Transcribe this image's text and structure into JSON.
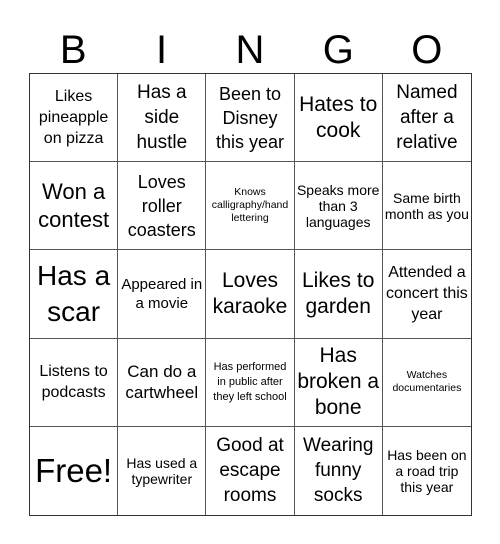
{
  "header": {
    "letters": [
      "B",
      "I",
      "N",
      "G",
      "O"
    ]
  },
  "cells": [
    {
      "text": "Likes pineapple on pizza",
      "size": "s16"
    },
    {
      "text": "Has a side hustle",
      "size": "s19"
    },
    {
      "text": "Been to Disney this year",
      "size": "s18"
    },
    {
      "text": "Hates to cook",
      "size": "s21"
    },
    {
      "text": "Named after a relative",
      "size": "s19"
    },
    {
      "text": "Won a contest",
      "size": "s22"
    },
    {
      "text": "Loves roller coasters",
      "size": "s18"
    },
    {
      "text": "Knows calligraphy/hand lettering",
      "size": "s10"
    },
    {
      "text": "Speaks more than 3 languages",
      "size": "s14"
    },
    {
      "text": "Same birth month as you",
      "size": "s14"
    },
    {
      "text": "Has a scar",
      "size": "s28"
    },
    {
      "text": "Appeared in a movie",
      "size": "s15"
    },
    {
      "text": "Loves karaoke",
      "size": "s21"
    },
    {
      "text": "Likes to garden",
      "size": "s21"
    },
    {
      "text": "Attended a concert this year",
      "size": "s16"
    },
    {
      "text": "Listens to podcasts",
      "size": "s16"
    },
    {
      "text": "Can do a cartwheel",
      "size": "s17"
    },
    {
      "text": "Has performed in public after they left school",
      "size": "s11"
    },
    {
      "text": "Has broken a bone",
      "size": "s21"
    },
    {
      "text": "Watches documentaries",
      "size": "s10"
    },
    {
      "text": "Free!",
      "size": "s33"
    },
    {
      "text": "Has used a typewriter",
      "size": "s14"
    },
    {
      "text": "Good at escape rooms",
      "size": "s19"
    },
    {
      "text": "Wearing funny socks",
      "size": "s19"
    },
    {
      "text": "Has been on a road trip this year",
      "size": "s14"
    }
  ]
}
